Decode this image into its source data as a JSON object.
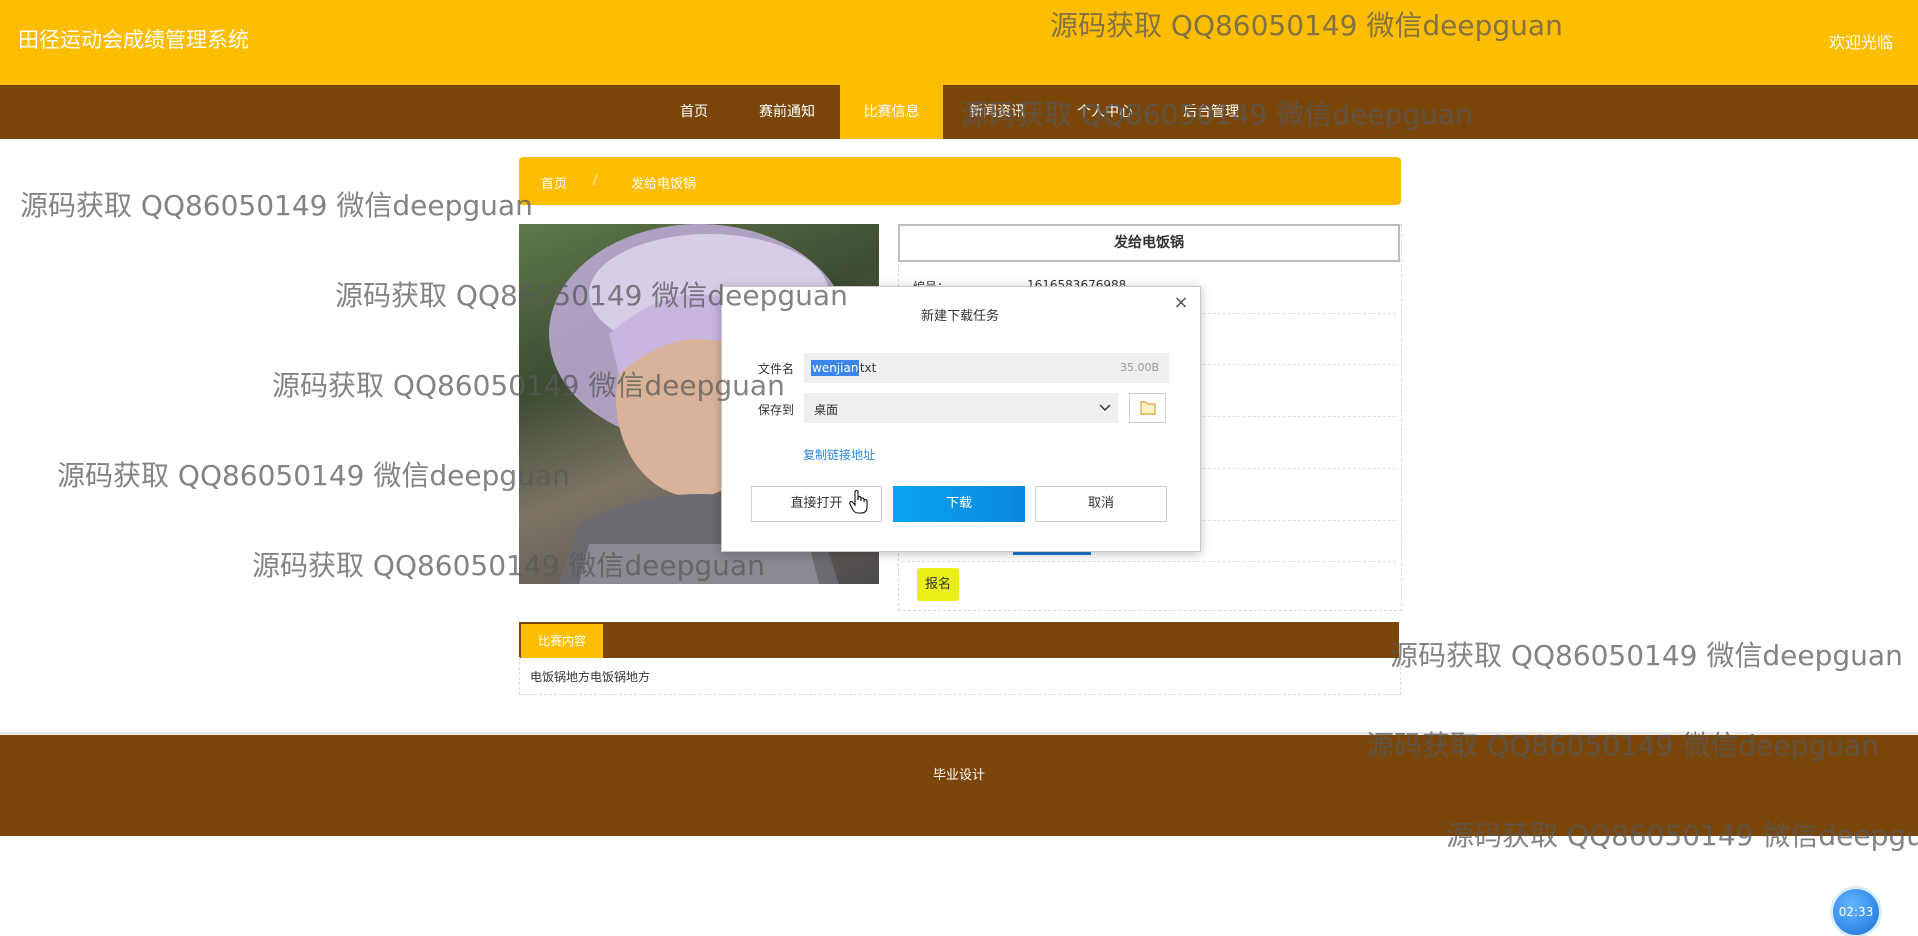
{
  "header": {
    "site_title": "田径运动会成绩管理系统",
    "welcome": "欢迎光临"
  },
  "nav": {
    "items": [
      {
        "label": "首页"
      },
      {
        "label": "赛前通知"
      },
      {
        "label": "比赛信息"
      },
      {
        "label": "新闻资讯"
      },
      {
        "label": "个人中心"
      },
      {
        "label": "后台管理"
      }
    ],
    "active_index": 2
  },
  "breadcrumb": {
    "home": "首页",
    "separator": "/",
    "current": "发给电饭锅"
  },
  "detail": {
    "title": "发给电饭锅",
    "id_label": "编号：",
    "id_value": "1616583676988",
    "signup_label": "报名"
  },
  "content": {
    "tab_label": "比赛内容",
    "text": "电饭锅地方电饭锅地方"
  },
  "footer": {
    "text": "毕业设计"
  },
  "download_dialog": {
    "title": "新建下载任务",
    "filename_label": "文件名",
    "filename_selected": "wenjian",
    "filename_rest": ".txt",
    "filesize": "35.00B",
    "saveto_label": "保存到",
    "saveto_value": "桌面",
    "copy_link": "复制链接地址",
    "open_label": "直接打开",
    "download_label": "下载",
    "cancel_label": "取消",
    "close_icon": "×"
  },
  "watermark": "源码获取 QQ86050149 微信deepguan",
  "timer": "02:33",
  "colors": {
    "brand_yellow": "#fdbd00",
    "brand_brown": "#7a460a",
    "signup_yellow": "#e9ef17",
    "download_blue": "#0a95e8"
  },
  "icons": [
    "close-icon",
    "chevron-down-icon",
    "folder-icon",
    "hand-cursor-icon"
  ]
}
